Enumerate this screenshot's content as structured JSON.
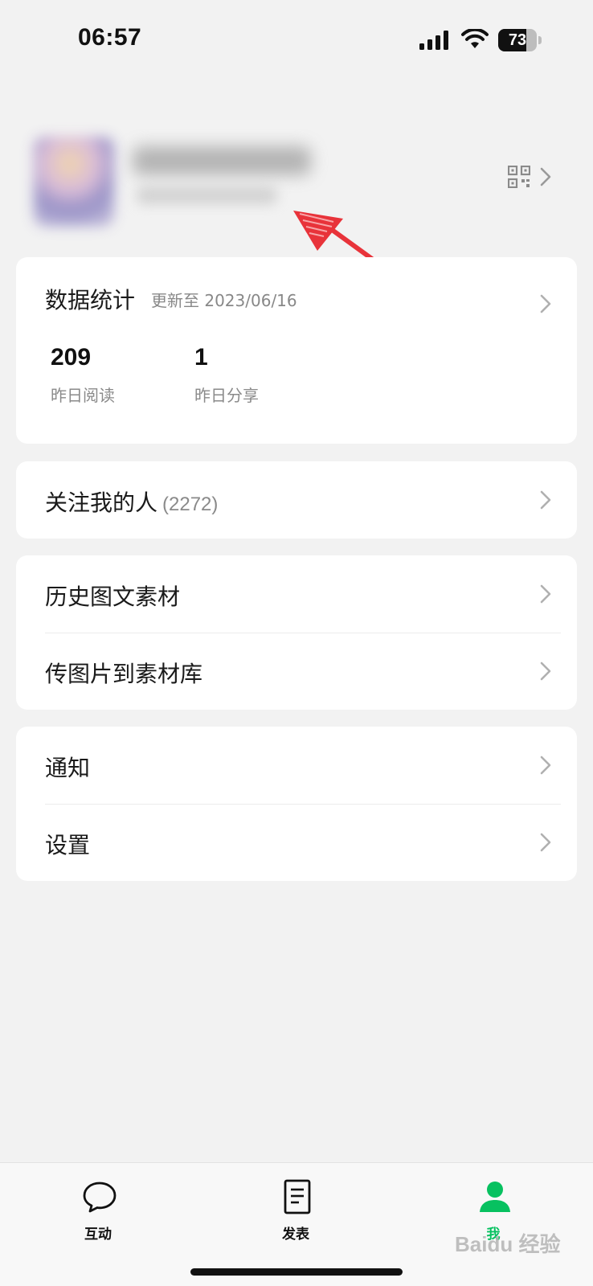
{
  "status_bar": {
    "time": "06:57",
    "battery": "73"
  },
  "stats": {
    "title": "数据统计",
    "updated": "更新至 2023/06/16",
    "items": [
      {
        "value": "209",
        "label": "昨日阅读"
      },
      {
        "value": "1",
        "label": "昨日分享"
      }
    ]
  },
  "followers": {
    "label": "关注我的人",
    "count": "(2272)"
  },
  "materials": {
    "history": "历史图文素材",
    "upload": "传图片到素材库"
  },
  "settings_group": {
    "notifications": "通知",
    "settings": "设置"
  },
  "tab_bar": {
    "tabs": [
      {
        "label": "互动",
        "icon": "chat-bubble-icon"
      },
      {
        "label": "发表",
        "icon": "document-icon"
      },
      {
        "label": "我",
        "icon": "person-icon",
        "active": true
      }
    ]
  },
  "watermark": "Baidu 经验",
  "colors": {
    "accent": "#07c160",
    "arrow": "#e8333a",
    "background": "#f2f2f2"
  }
}
